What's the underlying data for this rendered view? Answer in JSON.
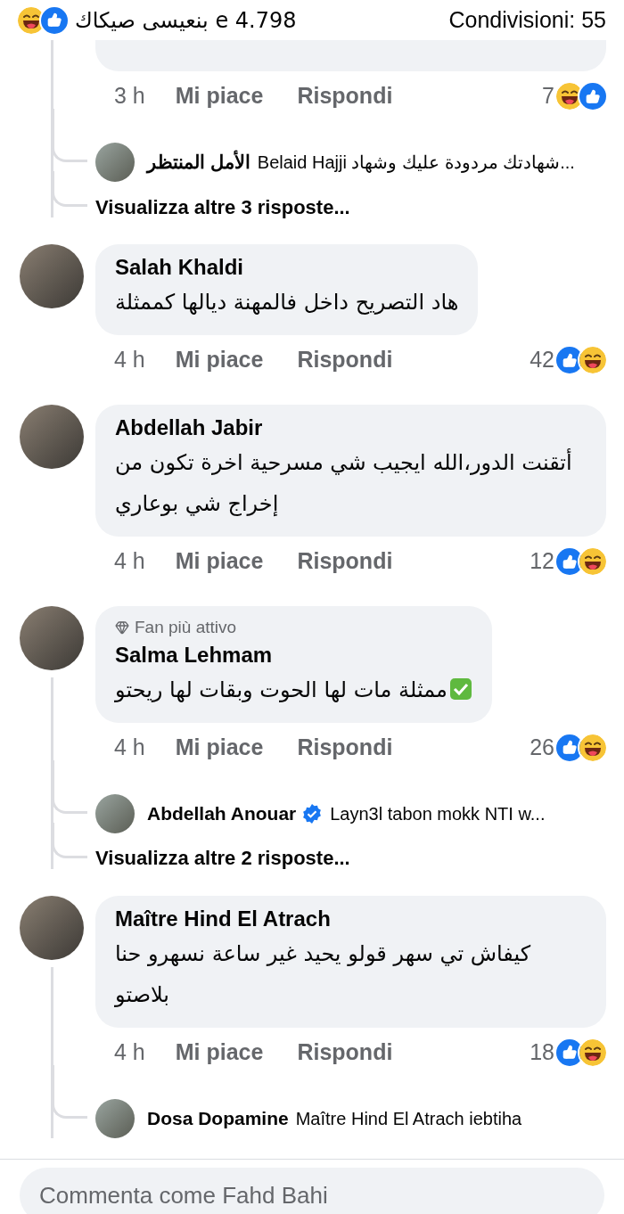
{
  "header": {
    "reactions": [
      {
        "kind": "haha"
      },
      {
        "kind": "like"
      }
    ],
    "reactors": "بنعيسى صيكاك e 4.798",
    "shares": "Condivisioni: 55"
  },
  "comments": [
    {
      "time": "3 h",
      "like": "Mi piace",
      "reply": "Rispondi",
      "count": "7",
      "reactions": [
        {
          "kind": "haha"
        },
        {
          "kind": "like"
        }
      ],
      "replies": [
        {
          "author": "الأمل المنتظر",
          "verified": false,
          "text": "Belaid Hajji شهادتك مردودة عليك وشهاد..."
        }
      ],
      "more": "Visualizza altre 3 risposte..."
    },
    {
      "author": "Salah Khaldi",
      "text": "هاد التصريح داخل فالمهنة ديالها كممثلة",
      "time": "4 h",
      "like": "Mi piace",
      "reply": "Rispondi",
      "count": "42",
      "reactions": [
        {
          "kind": "like"
        },
        {
          "kind": "haha"
        }
      ]
    },
    {
      "author": "Abdellah Jabir",
      "text": "أتقنت الدور،الله ايجيب شي مسرحية اخرة تكون من إخراج شي بوعاري",
      "time": "4 h",
      "like": "Mi piace",
      "reply": "Rispondi",
      "count": "12",
      "reactions": [
        {
          "kind": "like"
        },
        {
          "kind": "haha"
        }
      ]
    },
    {
      "author": "Salma Lehmam",
      "badge": "Fan più attivo",
      "text": "ممثلة مات لها الحوت وبقات لها ريحتو",
      "emoji": {
        "kind": "check"
      },
      "time": "4 h",
      "like": "Mi piace",
      "reply": "Rispondi",
      "count": "26",
      "reactions": [
        {
          "kind": "like"
        },
        {
          "kind": "haha"
        }
      ],
      "replies": [
        {
          "author": "Abdellah Anouar",
          "verified": true,
          "text": "Layn3l tabon mokk NTI w..."
        }
      ],
      "more": "Visualizza altre 2 risposte..."
    },
    {
      "author": "Maître Hind El Atrach",
      "text": "كيفاش تي سهر قولو يحيد غير ساعة نسهرو حنا بلاصتو",
      "time": "4 h",
      "like": "Mi piace",
      "reply": "Rispondi",
      "count": "18",
      "reactions": [
        {
          "kind": "like"
        },
        {
          "kind": "haha"
        }
      ],
      "replies": [
        {
          "author": "Dosa Dopamine",
          "verified": false,
          "text": "Maître Hind El Atrach iebtiha"
        }
      ]
    }
  ],
  "composer": {
    "placeholder": "Commenta come Fahd Bahi"
  }
}
